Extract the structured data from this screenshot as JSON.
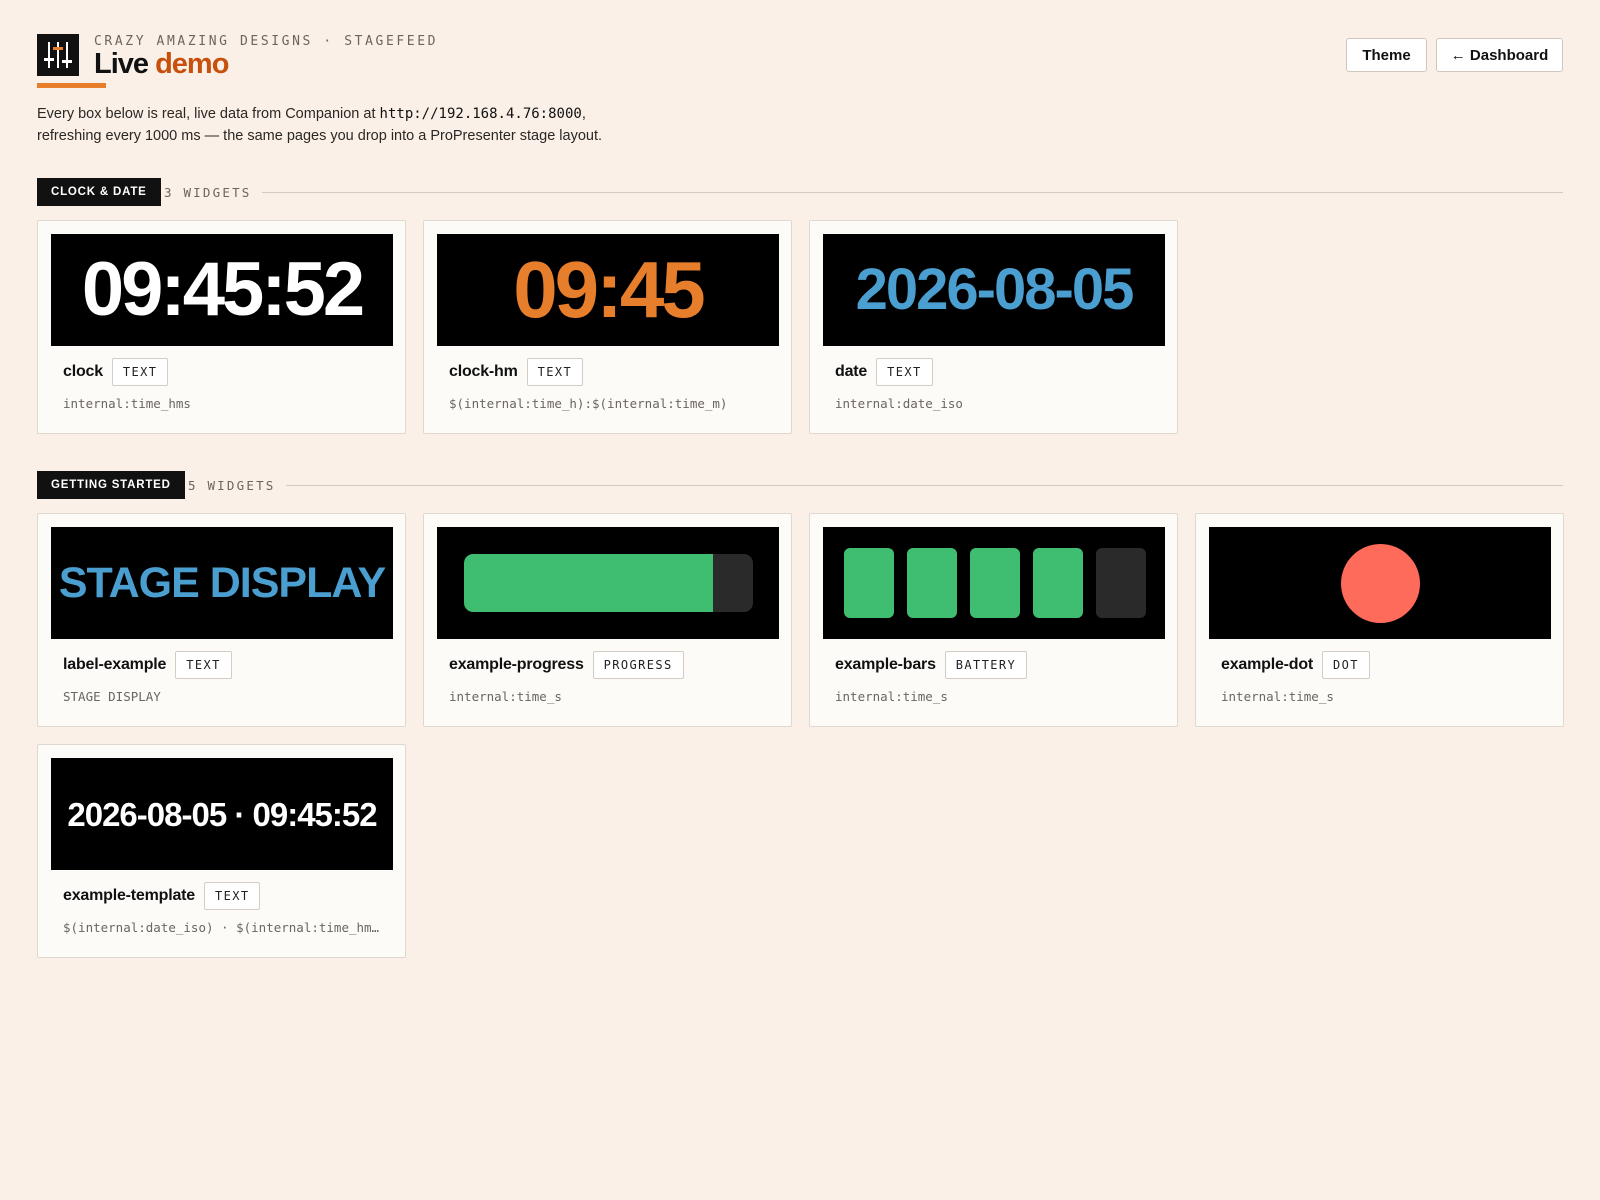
{
  "header": {
    "eyebrow": "CRAZY AMAZING DESIGNS · STAGEFEED",
    "title_part1": "Live",
    "title_part2": "demo",
    "intro_before": "Every box below is real, live data from Companion at ",
    "intro_url": "http://192.168.4.76:8000",
    "intro_after": ",",
    "intro_line2": "refreshing every 1000 ms — the same pages you drop into a ProPresenter stage layout.",
    "theme_button": "Theme",
    "dashboard_button": "← Dashboard",
    "logo_icon": "sliders-icon"
  },
  "colors": {
    "background": "#faf0e8",
    "accent_orange": "#e67e2b",
    "title_orange": "#c8500c",
    "blue": "#4a9fd0",
    "green": "#3fbe72",
    "dot_red": "#ff6b5b"
  },
  "sections": [
    {
      "tag": "CLOCK & DATE",
      "count": "3 WIDGETS",
      "widgets": [
        {
          "name": "clock",
          "type": "TEXT",
          "source": "internal:time_hms",
          "display": "09:45:52"
        },
        {
          "name": "clock-hm",
          "type": "TEXT",
          "source": "$(internal:time_h):$(internal:time_m)",
          "display": "09:45"
        },
        {
          "name": "date",
          "type": "TEXT",
          "source": "internal:date_iso",
          "display": "2026-08-05"
        }
      ]
    },
    {
      "tag": "GETTING STARTED",
      "count": "5 WIDGETS",
      "widgets": [
        {
          "name": "label-example",
          "type": "TEXT",
          "source": "STAGE DISPLAY",
          "display": "STAGE DISPLAY"
        },
        {
          "name": "example-progress",
          "type": "PROGRESS",
          "source": "internal:time_s",
          "progress": 0.86
        },
        {
          "name": "example-bars",
          "type": "BATTERY",
          "source": "internal:time_s",
          "bars_total": 5,
          "bars_on": 4
        },
        {
          "name": "example-dot",
          "type": "DOT",
          "source": "internal:time_s",
          "dot_color": "#ff6b5b"
        },
        {
          "name": "example-template",
          "type": "TEXT",
          "source": "$(internal:date_iso) · $(internal:time_hm…",
          "display": "2026-08-05 · 09:45:52"
        }
      ]
    }
  ]
}
